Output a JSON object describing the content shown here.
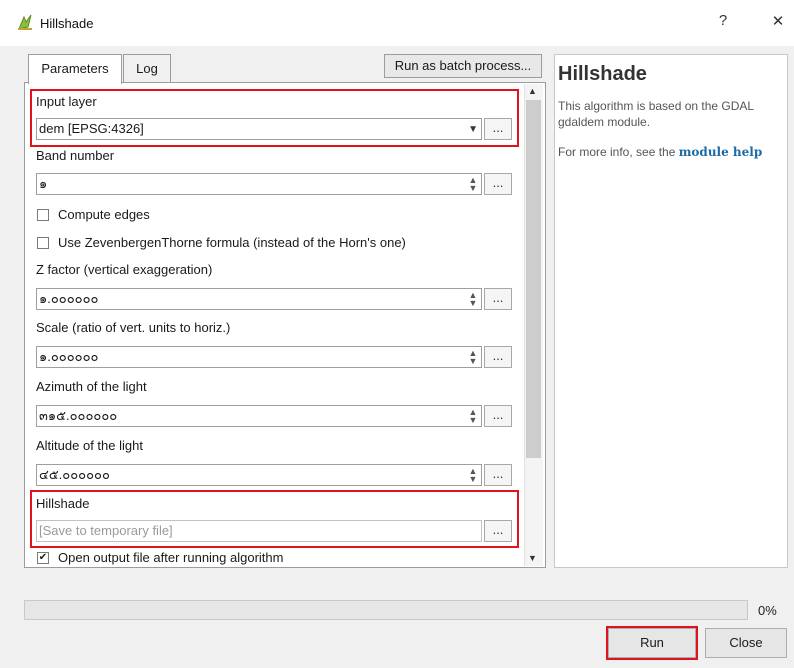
{
  "window": {
    "title": "Hillshade",
    "help_glyph": "?",
    "close_glyph": "✕",
    "icon": "qgis-icon"
  },
  "tabs": [
    {
      "label": "Parameters",
      "active": true
    },
    {
      "label": "Log",
      "active": false
    }
  ],
  "batch_button": "Run as batch process...",
  "params": {
    "input_layer": {
      "label": "Input layer",
      "value": "dem [EPSG:4326]"
    },
    "band_number": {
      "label": "Band number",
      "value": "๑"
    },
    "compute_edges": {
      "label": "Compute edges",
      "checked": false
    },
    "zevenbergen": {
      "label": "Use ZevenbergenThorne formula (instead of the Horn's one)",
      "checked": false
    },
    "z_factor": {
      "label": "Z factor (vertical exaggeration)",
      "value": "๑.๐๐๐๐๐๐"
    },
    "scale": {
      "label": "Scale (ratio of vert. units to horiz.)",
      "value": "๑.๐๐๐๐๐๐"
    },
    "azimuth": {
      "label": "Azimuth of the light",
      "value": "๓๑๕.๐๐๐๐๐๐"
    },
    "altitude": {
      "label": "Altitude of the light",
      "value": "๔๕.๐๐๐๐๐๐"
    },
    "hillshade": {
      "label": "Hillshade",
      "placeholder": "[Save to temporary file]"
    },
    "open_output": {
      "label": "Open output file after running algorithm",
      "checked": true
    }
  },
  "dots_label": "...",
  "help": {
    "title": "Hillshade",
    "body": "This algorithm is based on the GDAL gdaldem module.",
    "more_prefix": "For more info, see the ",
    "more_link": "module help"
  },
  "progress": {
    "value": 0,
    "label": "0%"
  },
  "buttons": {
    "run": "Run",
    "close": "Close"
  },
  "colors": {
    "highlight": "#e0131c",
    "link": "#1b6aa5"
  }
}
